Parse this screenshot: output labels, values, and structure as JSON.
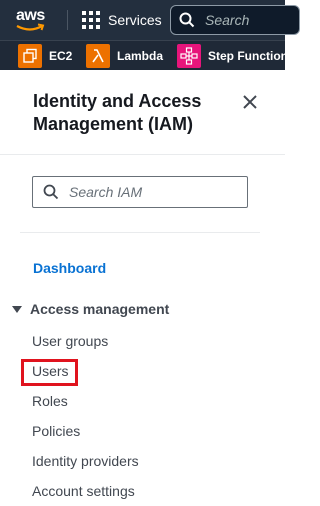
{
  "topbar": {
    "logo_text": "aws",
    "services_label": "Services",
    "search_placeholder": "Search"
  },
  "favorites": [
    {
      "label": "EC2",
      "icon": "ec2-icon",
      "color": "#ed7100"
    },
    {
      "label": "Lambda",
      "icon": "lambda-icon",
      "color": "#ed7100"
    },
    {
      "label": "Step Functions",
      "icon": "step-functions-icon",
      "color": "#e7157b"
    }
  ],
  "panel": {
    "title": "Identity and Access Management (IAM)",
    "search_placeholder": "Search IAM",
    "dashboard_label": "Dashboard",
    "section_label": "Access management",
    "items": [
      {
        "label": "User groups"
      },
      {
        "label": "Users",
        "highlighted": true
      },
      {
        "label": "Roles"
      },
      {
        "label": "Policies"
      },
      {
        "label": "Identity providers"
      },
      {
        "label": "Account settings"
      }
    ]
  },
  "colors": {
    "topbar_bg": "#232f3e",
    "link_blue": "#0972d3",
    "highlight_red": "#e0131e"
  }
}
